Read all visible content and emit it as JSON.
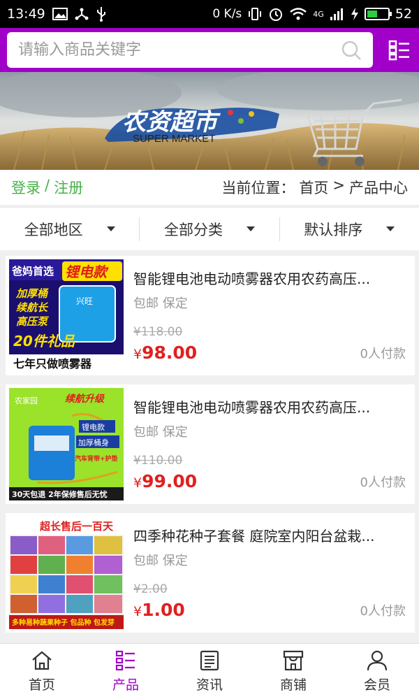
{
  "status_bar": {
    "time": "13:49",
    "net_speed": "0 K/s",
    "network": "4G",
    "battery": "52",
    "battery_level": 0.52
  },
  "search": {
    "placeholder": "请输入商品关键字"
  },
  "banner": {
    "logo_text": "农资超市",
    "subtitle": "SUPER MARKET"
  },
  "account": {
    "login": "登录",
    "separator": "/",
    "register": "注册"
  },
  "location": {
    "label": "当前位置：",
    "home": "首页",
    "arrow": ">",
    "current": "产品中心"
  },
  "filters": [
    {
      "label": "全部地区"
    },
    {
      "label": "全部分类"
    },
    {
      "label": "默认排序"
    }
  ],
  "products": [
    {
      "title": "智能锂电池电动喷雾器农用农药高压...",
      "tags": "包邮 保定",
      "old_price": "¥118.00",
      "yen": "¥",
      "price": "98.00",
      "paid": "0人付款",
      "thumb": {
        "line1": "爸妈首选",
        "line2": "锂电款",
        "line3": "加厚桶",
        "line4": "续航长",
        "line5": "高压泵",
        "line6": "20件礼品",
        "line7": "七年只做喷雾器",
        "tank_label": "兴旺"
      }
    },
    {
      "title": "智能锂电池电动喷雾器农用农药高压...",
      "tags": "包邮 保定",
      "old_price": "¥110.00",
      "yen": "¥",
      "price": "99.00",
      "paid": "0人付款",
      "thumb": {
        "brand": "农家园",
        "line1": "续航升级",
        "line2": "锂电款",
        "line3": "加厚桶身",
        "line4": "汽车背带+护垫",
        "line5": "30天包退 2年保修售后无忧"
      }
    },
    {
      "title": "四季种花种子套餐 庭院室内阳台盆栽...",
      "tags": "包邮 保定",
      "old_price": "¥2.00",
      "yen": "¥",
      "price": "1.00",
      "paid": "0人付款",
      "thumb": {
        "line1": "超长售后一百天",
        "line2": "多种易种蔬果种子 包品种 包发芽"
      }
    }
  ],
  "nav": [
    {
      "label": "首页",
      "icon": "home-icon"
    },
    {
      "label": "产品",
      "icon": "list-icon",
      "active": true
    },
    {
      "label": "资讯",
      "icon": "news-icon"
    },
    {
      "label": "商铺",
      "icon": "shop-icon"
    },
    {
      "label": "会员",
      "icon": "user-icon"
    }
  ],
  "colors": {
    "accent": "#a100c8",
    "price": "#e02020",
    "login": "#47b14a"
  }
}
